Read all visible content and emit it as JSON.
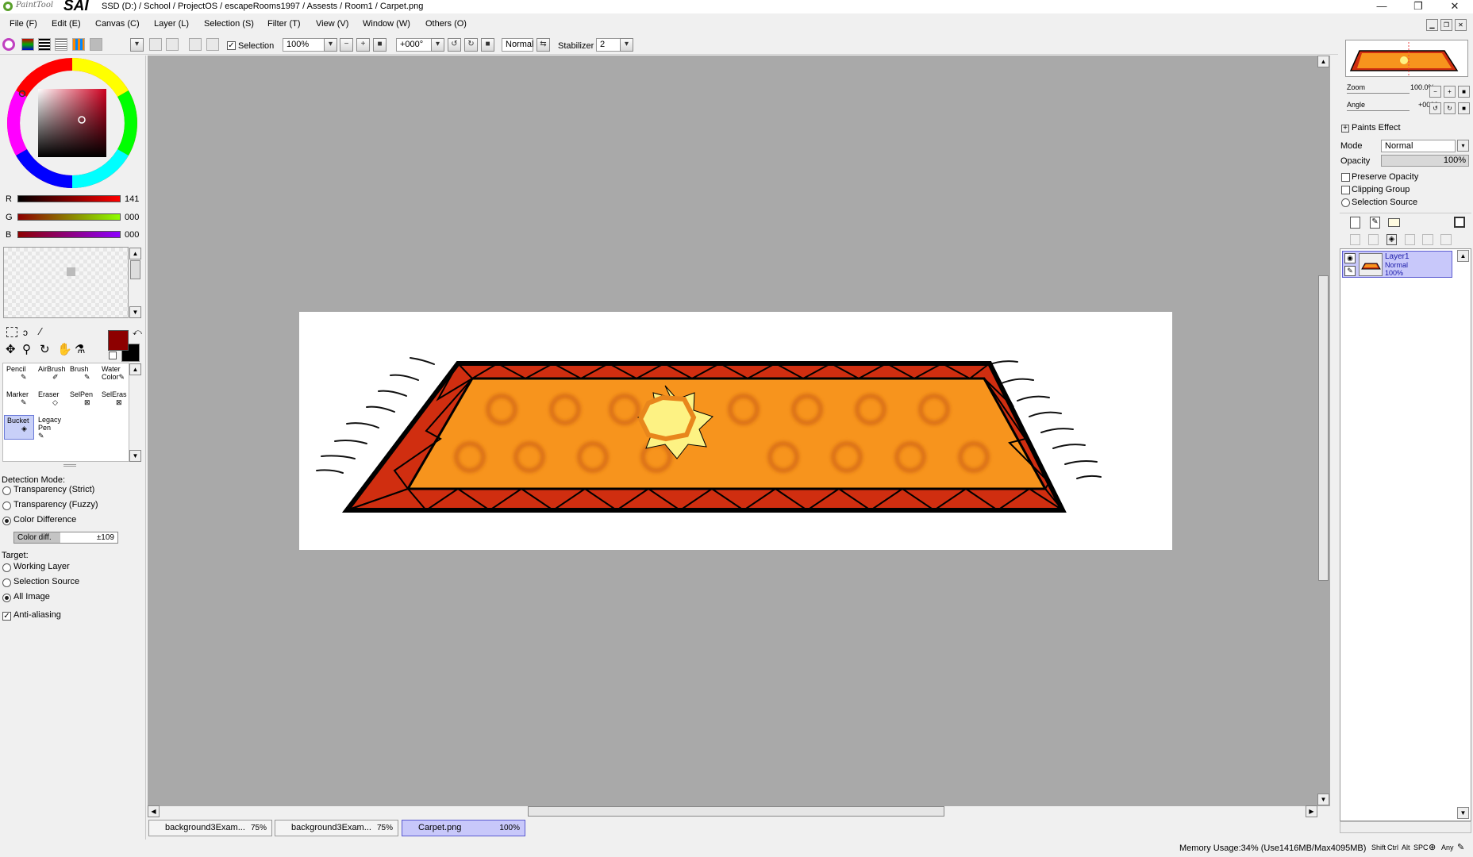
{
  "title_bar": {
    "logo_paint_tool": "PaintTool",
    "logo_sai": "SAI",
    "path": "SSD (D:) / School / ProjectOS / escapeRooms1997 / Assests / Room1 / Carpet.png",
    "minimize": "—",
    "maximize": "❐",
    "close": "✕"
  },
  "menu": {
    "items": [
      "File (F)",
      "Edit (E)",
      "Canvas (C)",
      "Layer (L)",
      "Selection (S)",
      "Filter (T)",
      "View (V)",
      "Window (W)",
      "Others (O)"
    ]
  },
  "toolbar": {
    "selection_label": "Selection",
    "selection_checked": true,
    "zoom_value": "100%",
    "angle_value": "+000°",
    "blend_mode": "Normal",
    "stabilizer_label": "Stabilizer",
    "stabilizer_value": "2"
  },
  "color": {
    "current_hex": "#8d0000",
    "background_hex": "#000000",
    "r_label": "R",
    "g_label": "G",
    "b_label": "B",
    "r_value": "141",
    "g_value": "000",
    "b_value": "000"
  },
  "tools": {
    "items": [
      {
        "label": "Pencil",
        "icon": "pencil-icon"
      },
      {
        "label": "AirBrush",
        "icon": "airbrush-icon"
      },
      {
        "label": "Brush",
        "icon": "brush-icon"
      },
      {
        "label": "Water Color",
        "icon": "watercolor-icon"
      },
      {
        "label": "Marker",
        "icon": "marker-icon"
      },
      {
        "label": "Eraser",
        "icon": "eraser-icon"
      },
      {
        "label": "SelPen",
        "icon": "selpen-icon"
      },
      {
        "label": "SelEras",
        "icon": "seleras-icon"
      },
      {
        "label": "Bucket",
        "icon": "bucket-icon",
        "selected": true
      },
      {
        "label": "Legacy Pen",
        "icon": "legacy-pen-icon"
      }
    ]
  },
  "bucket_options": {
    "detection_mode_label": "Detection Mode:",
    "detection_options": [
      "Transparency (Strict)",
      "Transparency (Fuzzy)",
      "Color Difference"
    ],
    "detection_selected": 2,
    "color_diff_label": "Color diff.",
    "color_diff_value": "±109",
    "target_label": "Target:",
    "target_options": [
      "Working Layer",
      "Selection Source",
      "All Image"
    ],
    "target_selected": 2,
    "anti_aliasing_label": "Anti-aliasing",
    "anti_aliasing_checked": true
  },
  "navigator": {
    "zoom_label": "Zoom",
    "zoom_value": "100.0%",
    "angle_label": "Angle",
    "angle_value": "+0000"
  },
  "layer_props": {
    "paints_effect_label": "Paints Effect",
    "mode_label": "Mode",
    "mode_value": "Normal",
    "opacity_label": "Opacity",
    "opacity_value": "100%",
    "preserve_opacity_label": "Preserve Opacity",
    "clipping_group_label": "Clipping Group",
    "selection_source_label": "Selection Source"
  },
  "layers": [
    {
      "name": "Layer1",
      "mode": "Normal",
      "opacity": "100%"
    }
  ],
  "tabs": [
    {
      "label": "background3Exam...",
      "zoom": "75%"
    },
    {
      "label": "background3Exam...",
      "zoom": "75%"
    },
    {
      "label": "Carpet.png",
      "zoom": "100%",
      "active": true
    }
  ],
  "status": {
    "memory": "Memory Usage:34% (Use1416MB/Max4095MB)",
    "keys": [
      "Shift",
      "Ctrl",
      "Alt",
      "SPC",
      "Any"
    ]
  },
  "colors": {
    "carpet_border": "#d02e10",
    "carpet_center": "#f7941d",
    "swirl": "#e07a1a",
    "sun": "#fdf283",
    "sun_ring": "#e8861c"
  }
}
